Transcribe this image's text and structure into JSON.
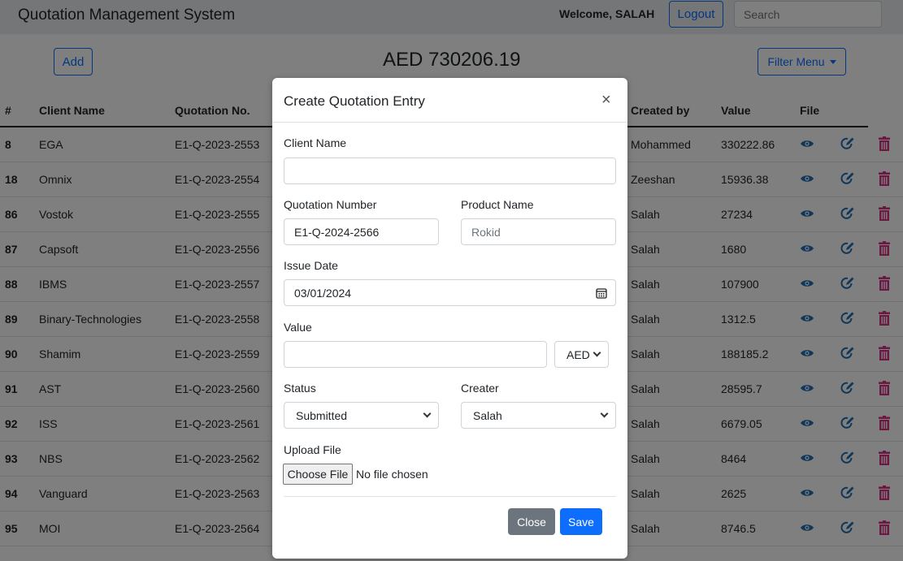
{
  "navbar": {
    "brand": "Quotation Management System",
    "welcome": "Welcome, SALAH",
    "logout_label": "Logout",
    "search_placeholder": "Search"
  },
  "toolbar": {
    "add_label": "Add",
    "total": "AED 730206.19",
    "filter_label": "Filter Menu"
  },
  "table": {
    "headers": {
      "id": "#",
      "client": "Client Name",
      "quotation": "Quotation No.",
      "created_by": "Created by",
      "value": "Value",
      "file": "File"
    },
    "rows": [
      {
        "id": "8",
        "client": "EGA",
        "quotation": "E1-Q-2023-2553",
        "created_by": "Mohammed",
        "value": "330222.86"
      },
      {
        "id": "18",
        "client": "Omnix",
        "quotation": "E1-Q-2023-2554",
        "created_by": "Zeeshan",
        "value": "15936.38"
      },
      {
        "id": "86",
        "client": "Vostok",
        "quotation": "E1-Q-2023-2555",
        "created_by": "Salah",
        "value": "27234"
      },
      {
        "id": "87",
        "client": "Capsoft",
        "quotation": "E1-Q-2023-2556",
        "created_by": "Salah",
        "value": "1680"
      },
      {
        "id": "88",
        "client": "IBMS",
        "quotation": "E1-Q-2023-2557",
        "created_by": "Salah",
        "value": "107900"
      },
      {
        "id": "89",
        "client": "Binary-Technologies",
        "quotation": "E1-Q-2023-2558",
        "created_by": "Salah",
        "value": "1312.5"
      },
      {
        "id": "90",
        "client": "Shamim",
        "quotation": "E1-Q-2023-2559",
        "created_by": "Salah",
        "value": "188185.2"
      },
      {
        "id": "91",
        "client": "AST",
        "quotation": "E1-Q-2023-2560",
        "created_by": "Salah",
        "value": "28595.7"
      },
      {
        "id": "92",
        "client": "ISS",
        "quotation": "E1-Q-2023-2561",
        "created_by": "Salah",
        "value": "6679.05"
      },
      {
        "id": "93",
        "client": "NBS",
        "quotation": "E1-Q-2023-2562",
        "created_by": "Salah",
        "value": "8464"
      },
      {
        "id": "94",
        "client": "Vanguard",
        "quotation": "E1-Q-2023-2563",
        "created_by": "Salah",
        "value": "2625"
      },
      {
        "id": "95",
        "client": "MOI",
        "quotation": "E1-Q-2023-2564",
        "created_by": "Salah",
        "value": "8746.5"
      }
    ]
  },
  "modal": {
    "title": "Create Quotation Entry",
    "close_icon_char": "×",
    "client_name_label": "Client Name",
    "client_name_value": "",
    "quotation_number_label": "Quotation Number",
    "quotation_number_value": "E1-Q-2024-2566",
    "product_name_label": "Product Name",
    "product_name_placeholder": "Rokid",
    "issue_date_label": "Issue Date",
    "issue_date_value": "03/01/2024",
    "value_label": "Value",
    "value_value": "",
    "currency_selected": "AED",
    "status_label": "Status",
    "status_selected": "Submitted",
    "creater_label": "Creater",
    "creater_selected": "Salah",
    "upload_label": "Upload File",
    "choose_file_label": "Choose File",
    "no_file_text": "No file chosen",
    "close_label": "Close",
    "save_label": "Save"
  },
  "colors": {
    "primary": "#0d6efd",
    "secondary": "#6c757d",
    "eye_icon": "#1f6fb2",
    "delete_icon": "#d63384"
  }
}
